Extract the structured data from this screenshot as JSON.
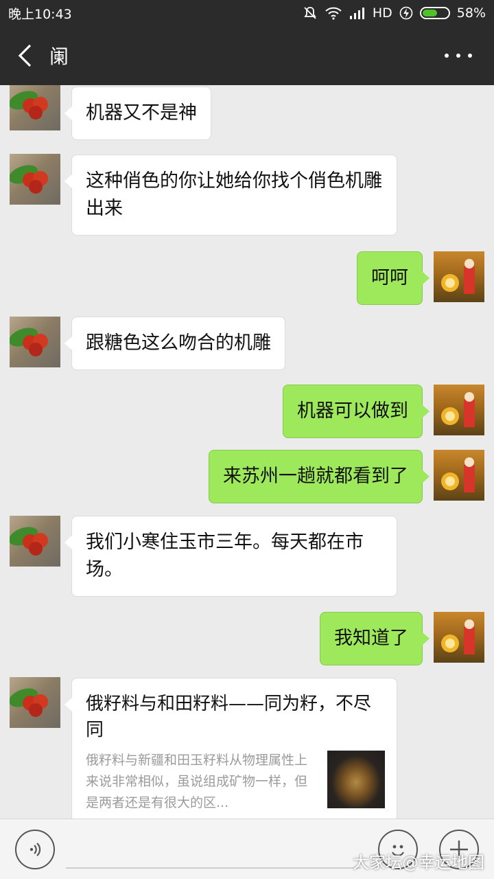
{
  "status_bar": {
    "time": "晚上10:43",
    "network": "HD",
    "battery": "58%",
    "battery_level": 0.58
  },
  "header": {
    "title": "阑"
  },
  "messages": [
    {
      "side": "left",
      "text": "机器又不是神"
    },
    {
      "side": "left",
      "text": "这种俏色的你让她给你找个俏色机雕出来"
    },
    {
      "side": "right",
      "text": "呵呵"
    },
    {
      "side": "left",
      "text": "跟糖色这么吻合的机雕"
    },
    {
      "side": "right",
      "text": "机器可以做到"
    },
    {
      "side": "right",
      "text": "来苏州一趟就都看到了"
    },
    {
      "side": "left",
      "text": "我们小寒住玉市三年。每天都在市场。"
    },
    {
      "side": "right",
      "text": "我知道了"
    }
  ],
  "link_card": {
    "title": "俄籽料与和田籽料——同为籽，不尽同",
    "description": "俄籽料与新疆和田玉籽料从物理属性上来说非常相似，虽说组成矿物一样，但是两者还是有很大的区..."
  },
  "watermark": "大家坛@幸运地图",
  "colors": {
    "header_bg": "#2b2b2b",
    "chat_bg": "#ebebeb",
    "sent_bubble": "#9ee85c",
    "received_bubble": "#ffffff"
  }
}
